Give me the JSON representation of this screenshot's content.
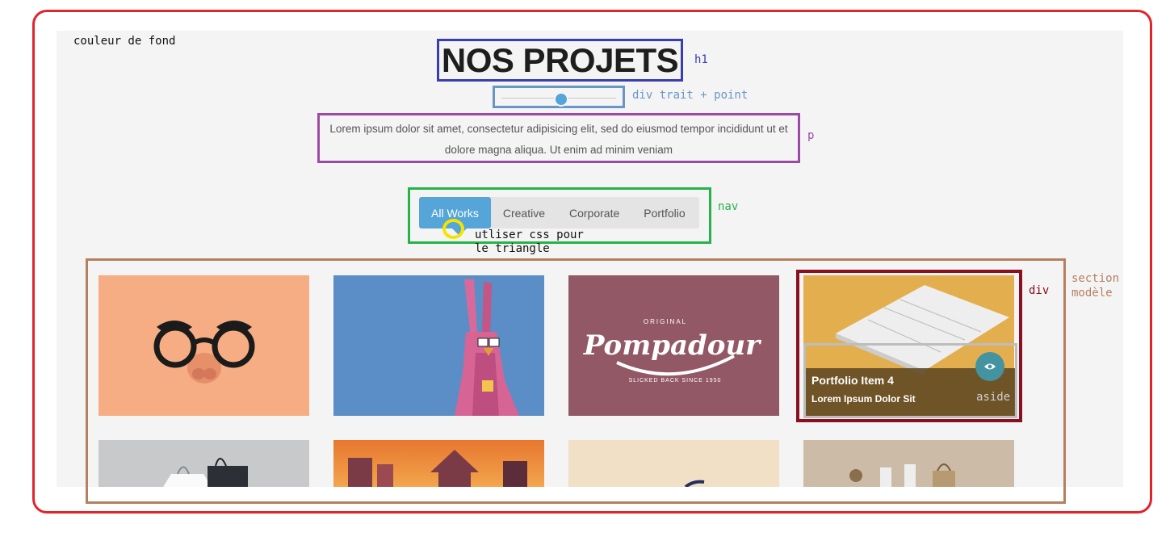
{
  "annotations": {
    "background": "couleur de fond",
    "h1": "h1",
    "div_line_dot": "div trait + point",
    "p": "p",
    "nav": "nav",
    "triangle": [
      "utliser css pour",
      "le triangle"
    ],
    "section": [
      "section",
      "modèle"
    ],
    "div": "div",
    "aside": "aside"
  },
  "header": {
    "title": "NOS PROJETS",
    "text": "Lorem ipsum dolor sit amet, consectetur adipisicing elit, sed do eiusmod tempor incididunt ut et dolore magna aliqua. Ut enim ad minim veniam"
  },
  "nav": {
    "items": [
      "All Works",
      "Creative",
      "Corporate",
      "Portfolio"
    ],
    "active": "All Works"
  },
  "portfolio": {
    "overlay_title": "Portfolio Item 4",
    "overlay_subtitle": "Lorem Ipsum Dolor Sit",
    "logo_text": "Pompadour",
    "logo_top": "ORIGINAL",
    "logo_bottom": "SLICKED BACK SINCE 1950"
  },
  "colors": {
    "frame": "#e0242c",
    "accent": "#56a5d8",
    "h1_box": "#3a3db0",
    "dot_box": "#6a96c6",
    "p_box": "#9c4aa6",
    "nav_box": "#27b24a",
    "section_box": "#b5805e",
    "div_box": "#8a1020"
  },
  "icons": [
    "eye-icon",
    "glasses-icon",
    "bunny-icon",
    "shopping-bags-icon",
    "city-skyline-icon"
  ]
}
